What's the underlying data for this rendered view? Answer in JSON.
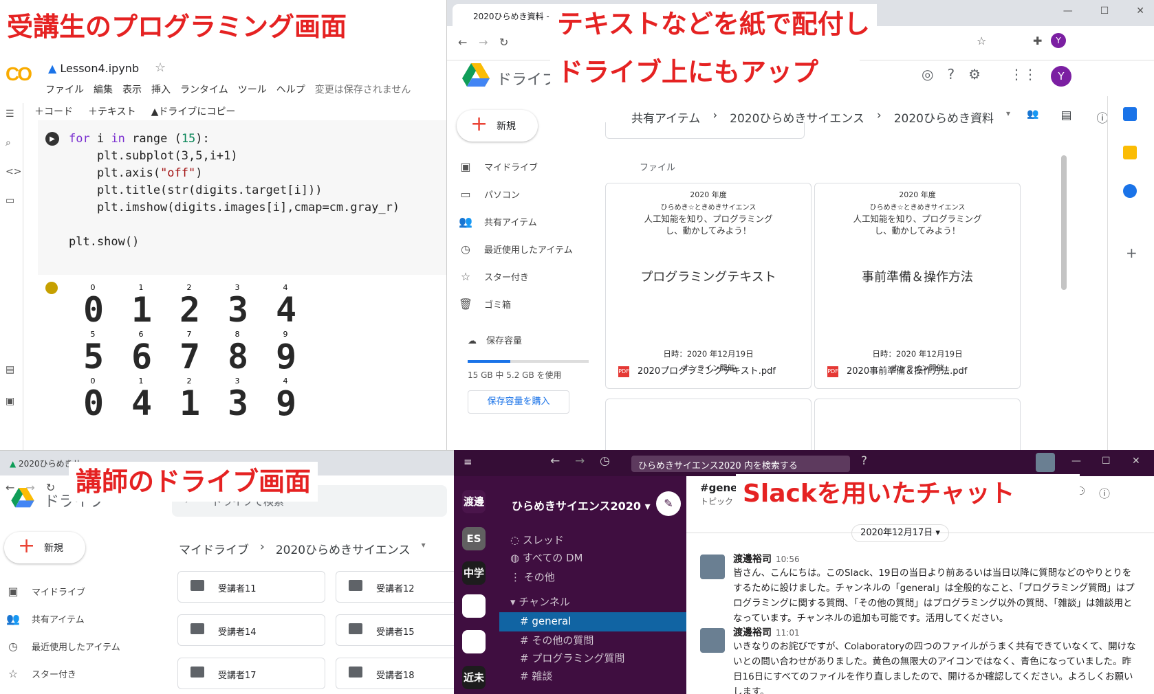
{
  "labels": {
    "student": "受講生のプログラミング画面",
    "text_line1": "テキストなどを紙で配付し",
    "text_line2": "ドライブ上にもアップ",
    "teacher": "講師のドライブ画面",
    "slack": "Slackを用いたチャット"
  },
  "colab": {
    "logo": "CO",
    "filename": "Lesson4.ipynb",
    "menu": [
      "ファイル",
      "編集",
      "表示",
      "挿入",
      "ランタイム",
      "ツール",
      "ヘルプ"
    ],
    "unsaved": "変更は保存されません",
    "toolbar": [
      "＋コード",
      "＋テキスト",
      "ドライブにコピー"
    ],
    "code": {
      "l1a": "for",
      "l1b": " i ",
      "l1c": "in",
      "l1d": " range (",
      "l1e": "15",
      "l1f": "):",
      "l2": "    plt.subplot(3,5,i+1)",
      "l3a": "    plt.axis(",
      "l3b": "\"off\"",
      "l3c": ")",
      "l4": "    plt.title(str(digits.target[i]))",
      "l5": "    plt.imshow(digits.images[i],cmap=cm.gray_r)",
      "l6": "plt.show()"
    },
    "digits": [
      {
        "label": "0",
        "glyph": "0"
      },
      {
        "label": "1",
        "glyph": "1"
      },
      {
        "label": "2",
        "glyph": "2"
      },
      {
        "label": "3",
        "glyph": "3"
      },
      {
        "label": "4",
        "glyph": "4"
      },
      {
        "label": "5",
        "glyph": "5"
      },
      {
        "label": "6",
        "glyph": "6"
      },
      {
        "label": "7",
        "glyph": "7"
      },
      {
        "label": "8",
        "glyph": "8"
      },
      {
        "label": "9",
        "glyph": "9"
      },
      {
        "label": "0",
        "glyph": "0"
      },
      {
        "label": "1",
        "glyph": "4"
      },
      {
        "label": "2",
        "glyph": "1"
      },
      {
        "label": "3",
        "glyph": "3"
      },
      {
        "label": "4",
        "glyph": "9"
      }
    ]
  },
  "drive1": {
    "tab": "2020ひらめき資料 - G",
    "title": "ドライブ",
    "new": "新規",
    "nav": [
      "マイドライブ",
      "パソコン",
      "共有アイテム",
      "最近使用したアイテム",
      "スター付き",
      "ゴミ箱"
    ],
    "storage_label": "保存容量",
    "storage_fill": 0.35,
    "storage_used": "15 GB 中 5.2 GB を使用",
    "buy": "保存容量を購入",
    "crumbs": [
      "共有アイテム",
      "2020ひらめきサイエンス",
      "2020ひらめき資料"
    ],
    "files_label": "ファイル",
    "files": [
      {
        "year": "2020 年度",
        "org": "ひらめき☆ときめきサイエンス",
        "sub": "人工知能を知り、プログラミングし、動かしてみよう！",
        "big": "プログラミングテキスト",
        "date": "日時：2020 年12月19日",
        "mode": "オンライン開催",
        "name": "2020プログラミングテキスト.pdf"
      },
      {
        "year": "2020 年度",
        "org": "ひらめき☆ときめきサイエンス",
        "sub": "人工知能を知り、プログラミングし、動かしてみよう！",
        "big": "事前準備＆操作方法",
        "date": "日時：2020 年12月19日",
        "mode": "オンライン開催",
        "name": "2020事前準備＆操作方法.pdf"
      }
    ],
    "avatar": "Y"
  },
  "drive2": {
    "tab": "2020ひらめきサ",
    "title": "ドライブ",
    "search": "ドライブで検索",
    "new": "新規",
    "nav": [
      "マイドライブ",
      "共有アイテム",
      "最近使用したアイテム",
      "スター付き"
    ],
    "crumbs": [
      "マイドライブ",
      "2020ひらめきサイエンス"
    ],
    "folders": [
      "受講者11",
      "受講者12",
      "受講者14",
      "受講者15",
      "受講者17",
      "受講者18"
    ]
  },
  "slack": {
    "search": "ひらめきサイエンス2020 内を検索する",
    "workspaces": [
      {
        "label": "渡邊",
        "color": "#4a154b"
      },
      {
        "label": "ES",
        "color": "#616061"
      },
      {
        "label": "中学",
        "color": "#1d1c1d"
      },
      {
        "label": "",
        "color": "#ffffff"
      },
      {
        "label": "",
        "color": "#ffffff"
      },
      {
        "label": "近未",
        "color": "#1d1c1d"
      }
    ],
    "workspace": "ひらめきサイエンス2020",
    "items": [
      "スレッド",
      "すべての DM",
      "その他"
    ],
    "channels_label": "チャンネル",
    "channels": [
      "general",
      "その他の質問",
      "プログラミング質問",
      "雑談"
    ],
    "channel_title": "#genera",
    "topic": "トピック",
    "date": "2020年12月17日",
    "messages": [
      {
        "who": "渡邊裕司",
        "time": "10:56",
        "text": "皆さん、こんにちは。このSlack、19日の当日より前あるいは当日以降に質問などのやりとりをするために設けました。チャンネルの「general」は全般的なこと、「プログラミング質問」はプログラミングに関する質問、「その他の質問」はプログラミング以外の質問、「雑談」は雑談用となっています。チャンネルの追加も可能です。活用してください。"
      },
      {
        "who": "渡邊裕司",
        "time": "11:01",
        "text": "いきなりのお詫びですが、Colaboratoryの四つのファイルがうまく共有できていなくて、開けないとの問い合わせがありました。黄色の無限大のアイコンではなく、青色になっていました。昨日16日にすべてのファイルを作り直しましたので、開けるか確認してください。よろしくお願いします。"
      }
    ]
  }
}
